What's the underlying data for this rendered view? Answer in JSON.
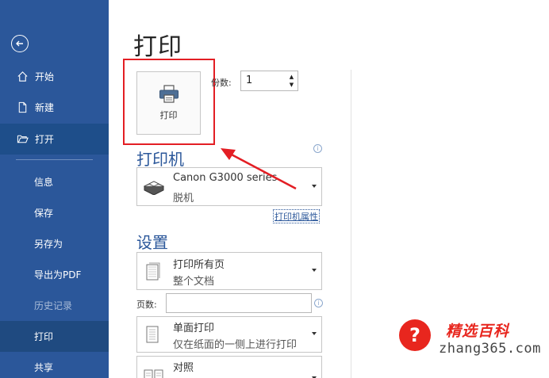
{
  "sidebar": {
    "items": [
      {
        "label": "开始",
        "icon": "home-icon"
      },
      {
        "label": "新建",
        "icon": "new-document-icon"
      },
      {
        "label": "打开",
        "icon": "open-folder-icon"
      },
      {
        "label": "信息"
      },
      {
        "label": "保存"
      },
      {
        "label": "另存为"
      },
      {
        "label": "导出为PDF"
      },
      {
        "label": "历史记录"
      },
      {
        "label": "打印"
      },
      {
        "label": "共享"
      }
    ]
  },
  "main": {
    "title": "打印",
    "print_button_label": "打印",
    "copies": {
      "label": "份数:",
      "value": "1"
    },
    "printer_section": {
      "heading": "打印机",
      "printer_name": "Canon G3000 series",
      "printer_status": "脱机",
      "properties_link": "打印机属性"
    },
    "settings_section": {
      "heading": "设置",
      "print_range": {
        "title": "打印所有页",
        "subtitle": "整个文档"
      },
      "pages_label": "页数:",
      "pages_value": "",
      "sides": {
        "title": "单面打印",
        "subtitle": "仅在纸面的一侧上进行打印"
      },
      "collation": {
        "title": "对照"
      }
    }
  },
  "watermark": {
    "brand": "精选百科",
    "url": "zhang365.com"
  },
  "colors": {
    "sidebar": "#2b579a",
    "accent": "#2b579a",
    "highlight": "#e31e24"
  }
}
